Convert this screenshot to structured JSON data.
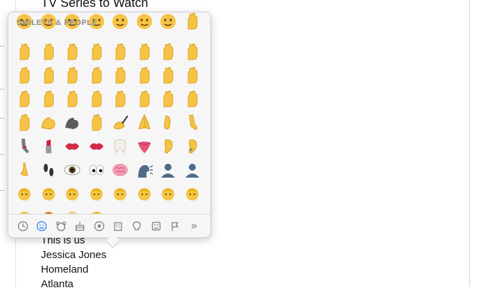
{
  "document": {
    "title": "TV Series to Watch",
    "lines": [
      "This is us",
      "Jessica Jones",
      "Homeland",
      "Atlanta"
    ]
  },
  "emoji_picker": {
    "section_header": "SMILEYS & PEOPLE",
    "visible_emoji_names": [
      "grinning-sweat-face",
      "crying-face",
      "sleeping-face",
      "kissing-face",
      "crying-face",
      "weary-face",
      "confounded-face",
      "open-hands",
      "palms-together-up",
      "raising-hands",
      "clapping-hands",
      "handshake",
      "thumbs-up",
      "thumbs-down",
      "oncoming-fist",
      "raised-fist",
      "left-facing-fist",
      "right-facing-fist",
      "crossed-fingers",
      "victory-hand",
      "sign-of-horns",
      "ok-hand",
      "backhand-index-left",
      "backhand-index-right",
      "backhand-index-up",
      "backhand-index-down",
      "index-pointing-up",
      "raised-back-of-hand",
      "raised-hand",
      "hand-with-fingers-splayed",
      "vulcan-salute",
      "waving-hand",
      "call-me-hand",
      "flexed-biceps",
      "flexed-biceps-dark",
      "middle-finger",
      "writing-hand",
      "folded-hands",
      "foot",
      "leg",
      "mechanical-leg",
      "lipstick",
      "kiss-mark",
      "mouth",
      "tooth",
      "tongue",
      "ear",
      "ear-with-hearing-aid",
      "nose",
      "footprints",
      "eye",
      "eyes",
      "brain",
      "speaking-head",
      "bust-in-silhouette",
      "busts-in-silhouette",
      "baby",
      "child",
      "boy",
      "girl",
      "woman",
      "person-blond",
      "man",
      "man-curly",
      "man-bald",
      "man-red-hair",
      "man-white-hair",
      "man-beard"
    ],
    "category_tabs": [
      {
        "name": "recent",
        "icon": "clock-icon",
        "active": false
      },
      {
        "name": "smileys-people",
        "icon": "smiley-icon",
        "active": true
      },
      {
        "name": "animals-nature",
        "icon": "bear-icon",
        "active": false
      },
      {
        "name": "food-drink",
        "icon": "cake-icon",
        "active": false
      },
      {
        "name": "activity",
        "icon": "soccer-ball-icon",
        "active": false
      },
      {
        "name": "travel-places",
        "icon": "building-icon",
        "active": false
      },
      {
        "name": "objects",
        "icon": "lightbulb-icon",
        "active": false
      },
      {
        "name": "symbols",
        "icon": "symbols-icon",
        "active": false
      },
      {
        "name": "flags",
        "icon": "flag-icon",
        "active": false
      },
      {
        "name": "more",
        "icon": "double-chevron-right-icon",
        "active": false
      }
    ],
    "more_glyph": "»",
    "colors": {
      "accent": "#2a7ff0",
      "skin": "#f6c445",
      "skin_shadow": "#d99a1b"
    }
  }
}
